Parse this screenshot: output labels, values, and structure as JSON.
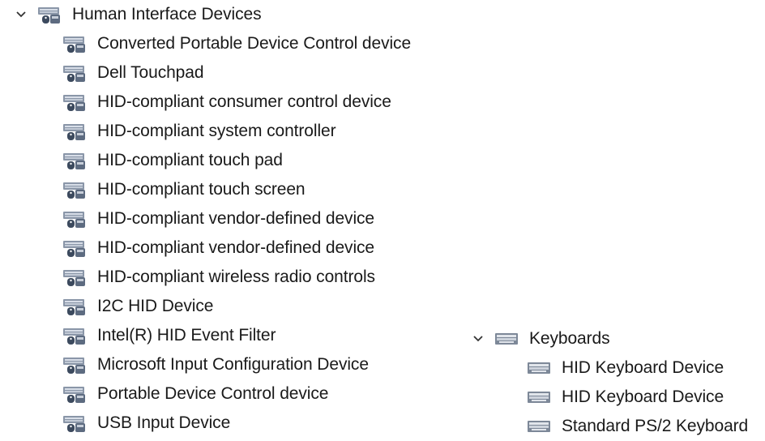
{
  "groups": [
    {
      "label": "Human Interface Devices",
      "expanded": true,
      "icon": "hid-device-icon",
      "children": [
        {
          "label": "Converted Portable Device Control device"
        },
        {
          "label": "Dell Touchpad"
        },
        {
          "label": "HID-compliant consumer control device"
        },
        {
          "label": "HID-compliant system controller"
        },
        {
          "label": "HID-compliant touch pad"
        },
        {
          "label": "HID-compliant touch screen"
        },
        {
          "label": "HID-compliant vendor-defined device"
        },
        {
          "label": "HID-compliant vendor-defined device"
        },
        {
          "label": "HID-compliant wireless radio controls"
        },
        {
          "label": "I2C HID Device"
        },
        {
          "label": "Intel(R) HID Event Filter"
        },
        {
          "label": "Microsoft Input Configuration Device"
        },
        {
          "label": "Portable Device Control device"
        },
        {
          "label": "USB Input Device"
        }
      ]
    },
    {
      "label": "Keyboards",
      "expanded": true,
      "icon": "keyboard-icon",
      "children": [
        {
          "label": "HID Keyboard Device"
        },
        {
          "label": "HID Keyboard Device"
        },
        {
          "label": "Standard PS/2 Keyboard"
        }
      ]
    }
  ]
}
